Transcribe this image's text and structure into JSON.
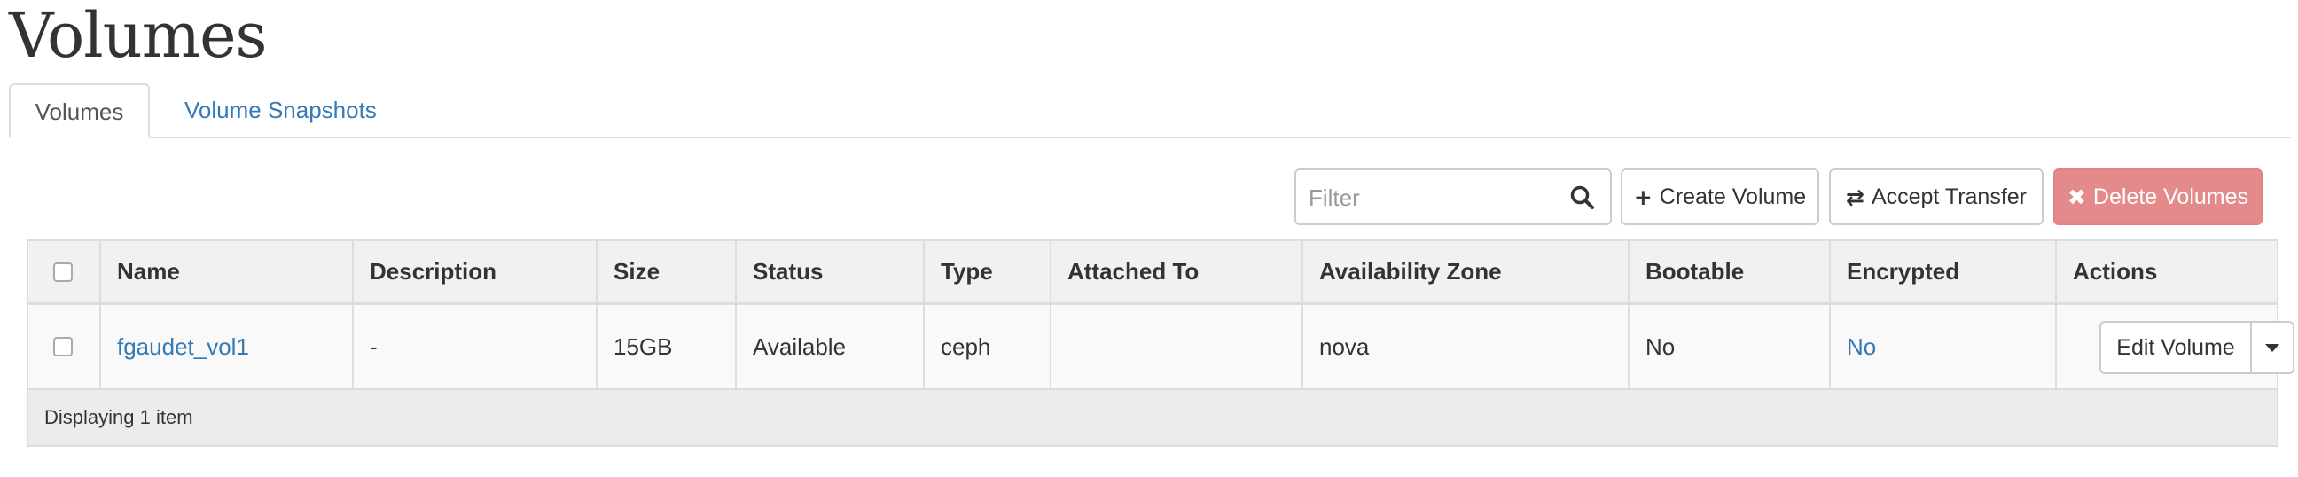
{
  "page": {
    "title": "Volumes"
  },
  "tabs": [
    {
      "label": "Volumes",
      "active": true
    },
    {
      "label": "Volume Snapshots",
      "active": false
    }
  ],
  "toolbar": {
    "filter_placeholder": "Filter",
    "filter_value": "",
    "create_label": "Create Volume",
    "accept_label": "Accept Transfer",
    "delete_label": "Delete Volumes",
    "create_icon": "plus-icon",
    "accept_icon": "transfer-icon",
    "delete_icon": "times-icon",
    "delete_color": "#e58a8a"
  },
  "table": {
    "columns": [
      "Name",
      "Description",
      "Size",
      "Status",
      "Type",
      "Attached To",
      "Availability Zone",
      "Bootable",
      "Encrypted",
      "Actions"
    ],
    "rows": [
      {
        "name": "fgaudet_vol1",
        "description": "-",
        "size": "15GB",
        "status": "Available",
        "type": "ceph",
        "attached_to": "",
        "availability_zone": "nova",
        "bootable": "No",
        "encrypted": "No",
        "action_label": "Edit Volume"
      }
    ],
    "footer": "Displaying 1 item"
  },
  "colors": {
    "link": "#337ab7",
    "header_bg": "#f1f1f1",
    "row_bg": "#f9f9f9"
  }
}
